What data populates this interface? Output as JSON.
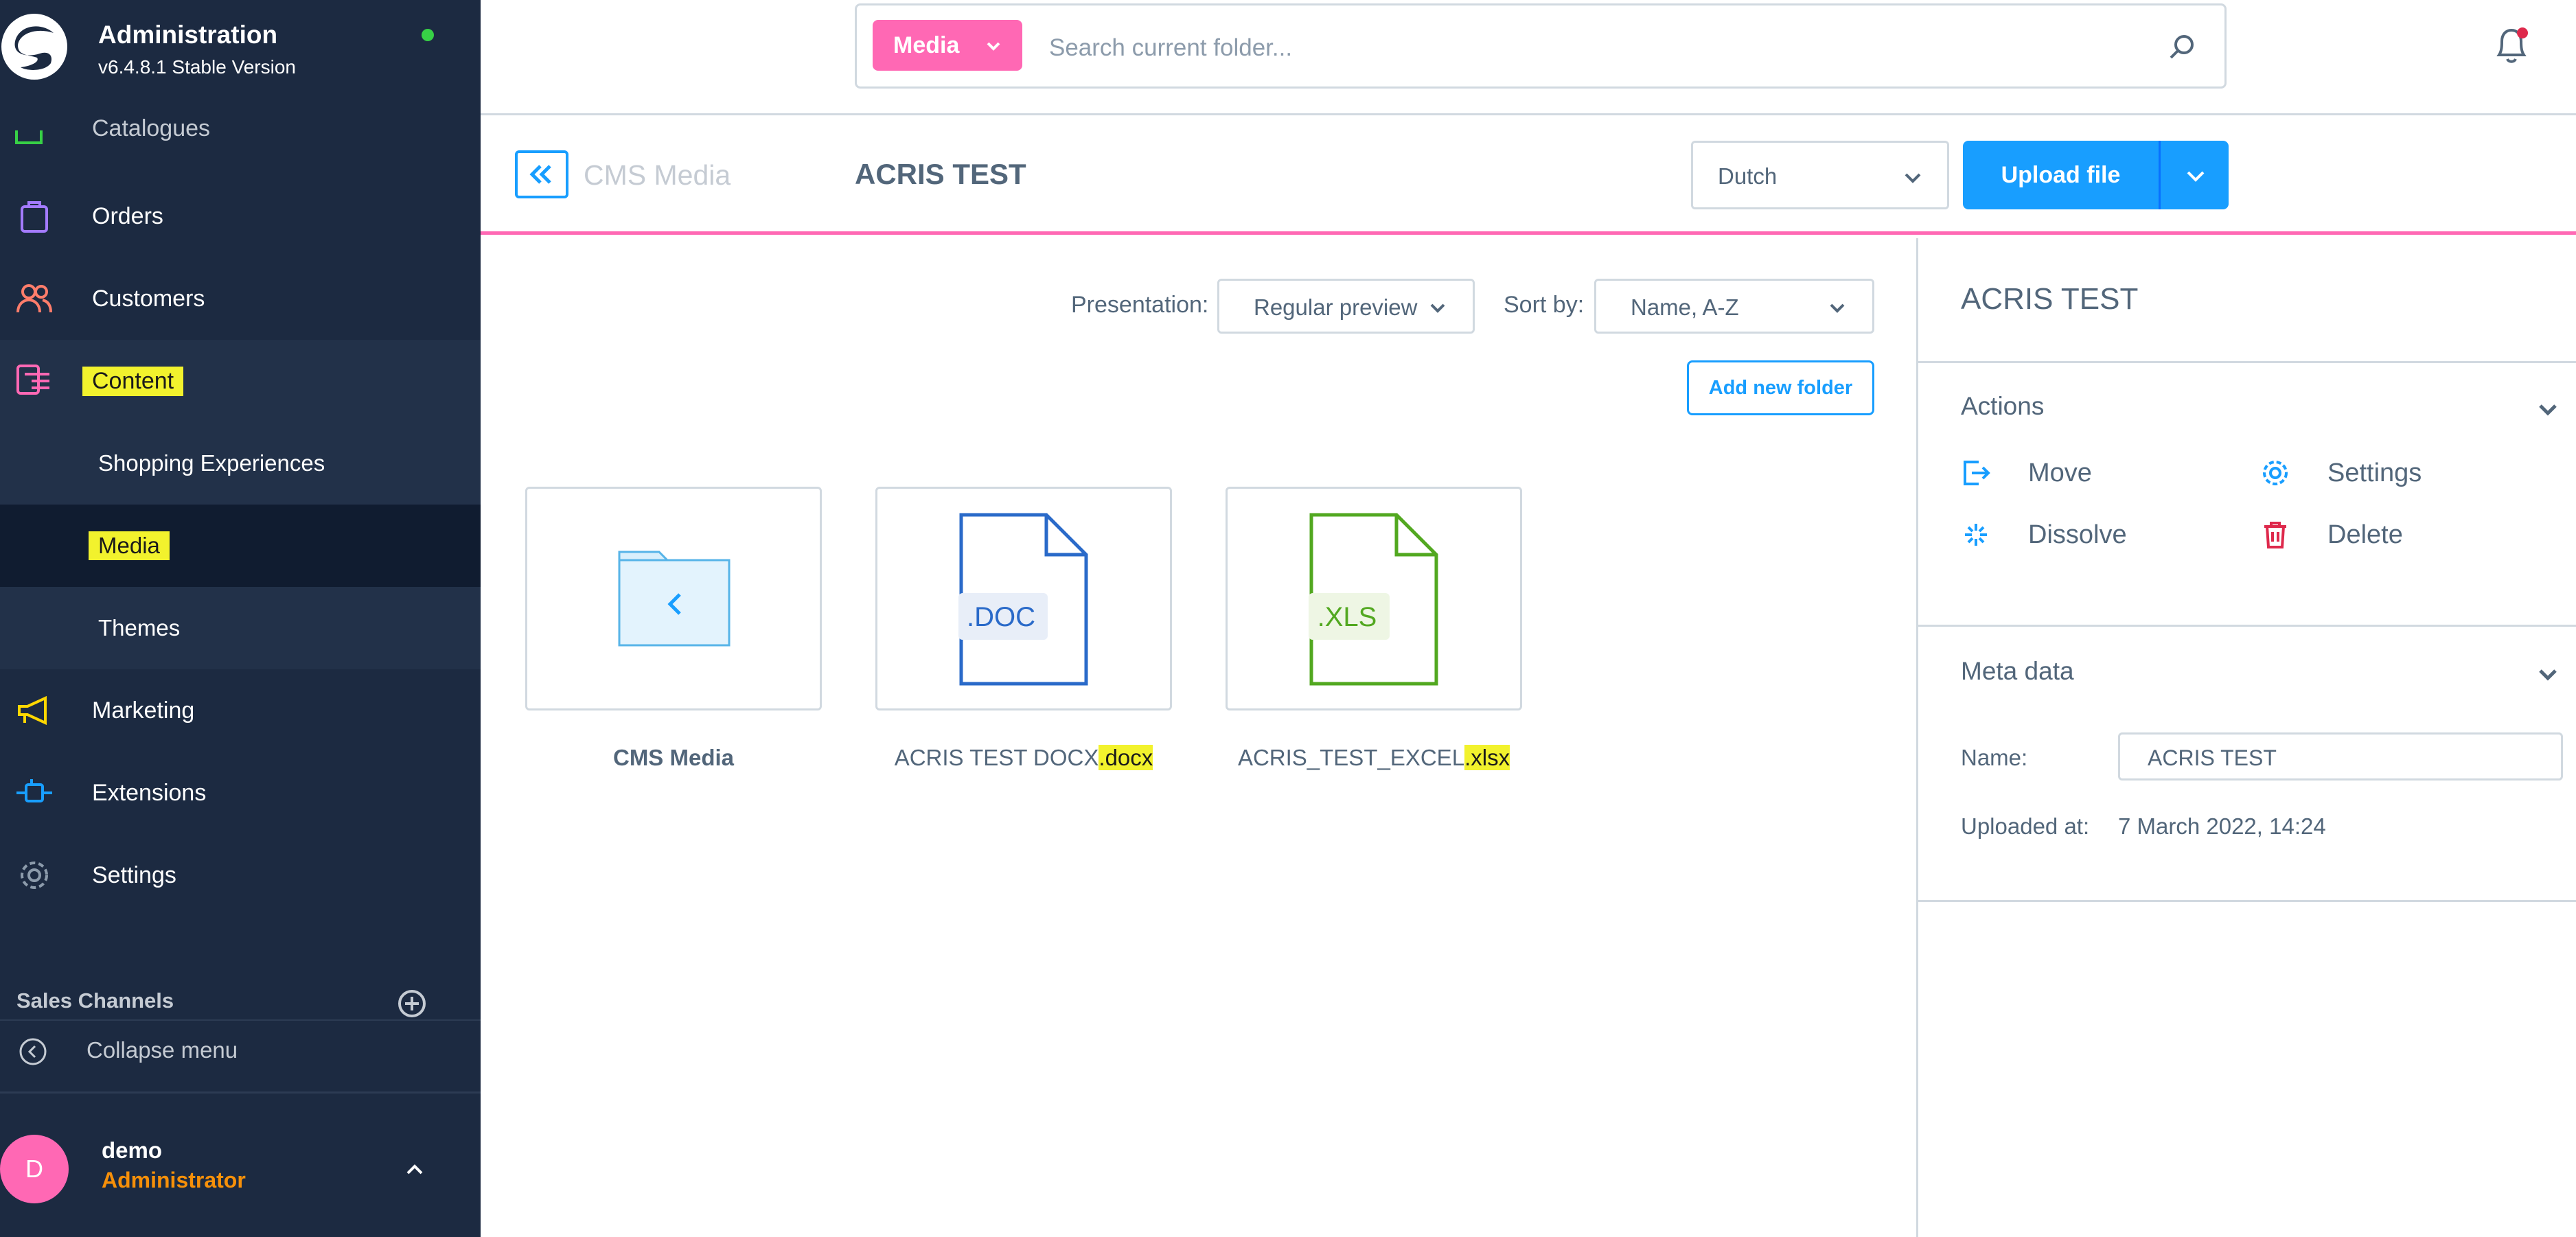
{
  "app": {
    "title": "Administration",
    "version": "v6.4.8.1 Stable Version"
  },
  "sidebar": {
    "cut_item": "Catalogues",
    "items": [
      {
        "label": "Orders",
        "icon": "bag-icon"
      },
      {
        "label": "Customers",
        "icon": "users-icon"
      },
      {
        "label": "Content",
        "icon": "content-icon"
      },
      {
        "label": "Marketing",
        "icon": "megaphone-icon"
      },
      {
        "label": "Extensions",
        "icon": "plug-icon"
      },
      {
        "label": "Settings",
        "icon": "gear-icon"
      }
    ],
    "content_sub": [
      "Shopping Experiences",
      "Media",
      "Themes"
    ],
    "sales_channels": "Sales Channels",
    "collapse": "Collapse menu",
    "user": {
      "initial": "D",
      "name": "demo",
      "role": "Administrator"
    }
  },
  "search": {
    "type": "Media",
    "placeholder": "Search current folder..."
  },
  "header": {
    "back_label": "CMS Media",
    "title": "ACRIS TEST",
    "language": "Dutch",
    "upload": "Upload file"
  },
  "toolbar": {
    "presentation_label": "Presentation:",
    "presentation_value": "Regular preview",
    "sort_label": "Sort by:",
    "sort_value": "Name, A-Z",
    "add_folder": "Add new folder"
  },
  "items": [
    {
      "name": "CMS Media"
    },
    {
      "name_base": "ACRIS TEST DOCX",
      "name_ext": ".docx",
      "badge": ".DOC"
    },
    {
      "name_base": "ACRIS_TEST_EXCEL",
      "name_ext": ".xlsx",
      "badge": ".XLS"
    }
  ],
  "panel": {
    "title": "ACRIS TEST",
    "actions_title": "Actions",
    "actions": {
      "move": "Move",
      "settings": "Settings",
      "dissolve": "Dissolve",
      "delete": "Delete"
    },
    "meta_title": "Meta data",
    "name_label": "Name:",
    "name_value": "ACRIS TEST",
    "uploaded_label": "Uploaded at:",
    "uploaded_value": "7 March 2022, 14:24"
  },
  "colors": {
    "sidebar": "#1c2a41",
    "accent": "#189eff",
    "brand_pink": "#ff68b4",
    "highlight": "#f2f22d"
  }
}
